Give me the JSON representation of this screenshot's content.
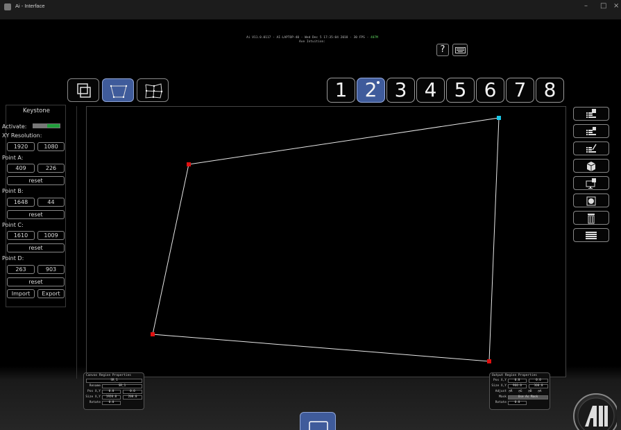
{
  "window": {
    "title": "Ai - Interface",
    "minimize": "–",
    "maximize": "□",
    "close": "×"
  },
  "status": {
    "line1_prefix": "Ai V11.0.0117 - AI-LAPTOP-40 - Wed Dec 5 17:35:04 2018 - 30 FPS - ",
    "line1_fps": "407M",
    "line2": "Ave Intuition:"
  },
  "help_label": "?",
  "mode_buttons": [
    "canvas-region-icon",
    "keystone-icon",
    "mesh-warp-icon"
  ],
  "active_mode": "keystone",
  "outputs": [
    "1",
    "2",
    "3",
    "4",
    "5",
    "6",
    "7",
    "8"
  ],
  "active_output": "2",
  "keystone": {
    "title": "Keystone",
    "activate_label": "Activate:",
    "resolution_label": "XY Resolution:",
    "resolution_x": "1920",
    "resolution_y": "1080",
    "point_a_label": "Point A:",
    "point_a_x": "409",
    "point_a_y": "226",
    "point_b_label": "Point B:",
    "point_b_x": "1648",
    "point_b_y": "44",
    "point_c_label": "Point C:",
    "point_c_x": "1610",
    "point_c_y": "1009",
    "point_d_label": "Point D:",
    "point_d_x": "263",
    "point_d_y": "903",
    "reset_label": "reset",
    "import_label": "Import",
    "export_label": "Export"
  },
  "colors": {
    "accent": "#3f5b9b",
    "handle": "#e01010",
    "selected_handle": "#19c8e8",
    "activate_on": "#1f9e3a"
  },
  "canvas_region": {
    "title": "Canvas Region Properties",
    "region_name": "SR_1",
    "rename_label": "Rename",
    "rename_value": "SR_1",
    "pos_label": "Pos X,Y",
    "pos_x": "0.0",
    "pos_y": "0.0",
    "size_label": "Size X,Y",
    "size_x": "1920.0",
    "size_y": "200.0",
    "rotate_label": "Rotate",
    "rotate_value": "0.0"
  },
  "output_region": {
    "title": "Output Region Properties",
    "pos_label": "Pos X,Y",
    "pos_x": "0.0",
    "pos_y": "0.0",
    "size_label": "Size X,Y",
    "size_x": "960.0",
    "size_y": "300.0",
    "adjust_label": "Adjust",
    "adjust_r": "R",
    "adjust_g": "G",
    "adjust_b": "B",
    "adjust_a": "A",
    "mask_label": "Mask",
    "mask_value": "Use As Mask",
    "rotate_label": "Rotate",
    "rotate_value": "0.0"
  },
  "side_tools": [
    "list-check-icon",
    "list-add-icon",
    "list-edit-icon",
    "cube-add-icon",
    "monitor-add-icon",
    "record-icon",
    "trash-icon",
    "grid-icon"
  ]
}
